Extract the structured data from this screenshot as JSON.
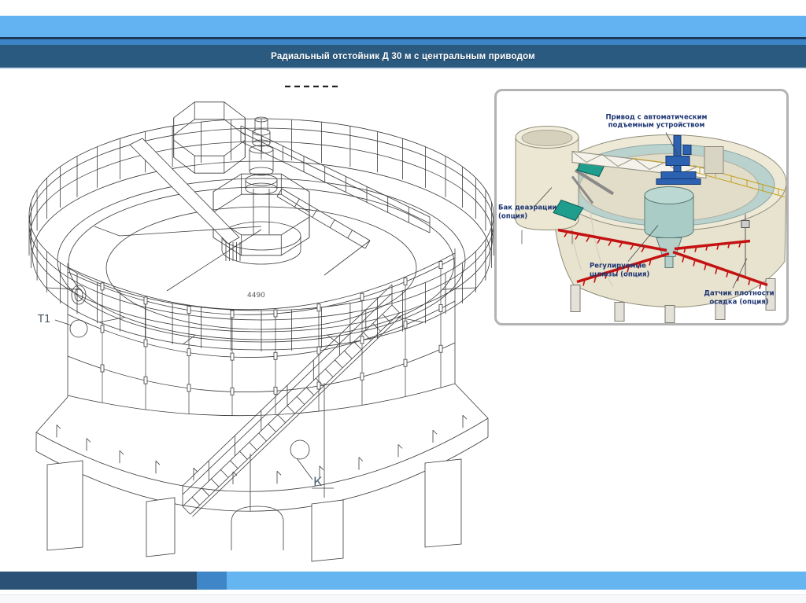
{
  "header": {
    "title": "Радиальный отстойник Д 30 м с центральным приводом"
  },
  "colors": {
    "light_blue": "#63b2f1",
    "navy_line": "#1c3a57",
    "medium_blue": "#3d84c6",
    "dark_blue": "#2b5a80",
    "footer_dark": "#2b5276",
    "footer_mid": "#3f86c8",
    "footer_light": "#64b5f0",
    "label_navy": "#1d3572",
    "scraper_red": "#c41212",
    "drive_blue": "#2d62b2",
    "chute_teal": "#1f9d8d",
    "railing_yellow": "#c2a01c",
    "tank_beige": "#e8e3cf"
  },
  "main_drawing": {
    "callout_t1": "Т1",
    "callout_k": "К",
    "dimension_label": "4490"
  },
  "inset": {
    "labels": {
      "drive": [
        "Привод с автоматическим",
        "подъемным устройством"
      ],
      "deaeration": [
        "Бак деаэрации",
        "(опция)"
      ],
      "sluices": [
        "Регулируемые",
        "шлюзы (опция)"
      ],
      "sensor": [
        "Датчик плотности",
        "осадка (опция)"
      ]
    }
  }
}
